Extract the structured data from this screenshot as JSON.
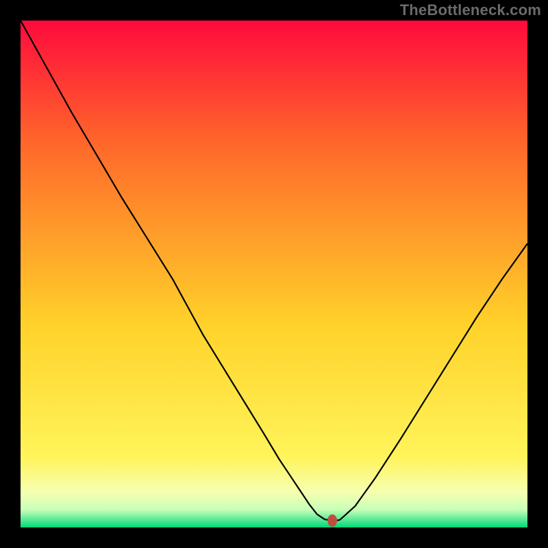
{
  "watermark": "TheBottleneck.com",
  "colors": {
    "page_bg": "#000000",
    "watermark": "#6b6b6b",
    "curve": "#000000",
    "marker_fill": "#be4f3e",
    "gradient_top": "#ff0a3c",
    "gradient_upper_mid": "#ff6a2a",
    "gradient_mid": "#ffd22a",
    "gradient_lower_mid": "#fff45a",
    "gradient_pale": "#f6ffb0",
    "gradient_pale2": "#c8ffb8",
    "gradient_bottom": "#00d97a"
  },
  "layout": {
    "outer_w": 800,
    "outer_h": 800,
    "border": 30,
    "inner_w": 740,
    "inner_h": 740
  },
  "chart_data": {
    "type": "line",
    "title": "",
    "xlabel": "",
    "ylabel": "",
    "xlim": [
      0,
      100
    ],
    "ylim": [
      0,
      100
    ],
    "x": [
      0,
      5,
      10,
      15,
      20,
      25,
      30,
      33,
      36,
      40,
      44,
      48,
      51,
      53,
      55,
      57,
      58.5,
      60,
      62,
      63,
      66,
      70,
      75,
      80,
      85,
      90,
      95,
      100
    ],
    "curve_y": [
      100,
      91,
      82,
      73.5,
      65,
      57,
      49,
      43.5,
      38,
      31.5,
      25,
      18.5,
      13.5,
      10.5,
      7.5,
      4.5,
      2.6,
      1.6,
      1.3,
      1.5,
      4.2,
      9.8,
      17.5,
      25.5,
      33.5,
      41.5,
      49,
      56
    ],
    "marker": {
      "x": 61.5,
      "y": 1.35
    },
    "gradient_stops": [
      {
        "offset": 0.0,
        "color_key": "gradient_top"
      },
      {
        "offset": 0.25,
        "color_key": "gradient_upper_mid"
      },
      {
        "offset": 0.6,
        "color_key": "gradient_mid"
      },
      {
        "offset": 0.86,
        "color_key": "gradient_lower_mid"
      },
      {
        "offset": 0.93,
        "color_key": "gradient_pale"
      },
      {
        "offset": 0.965,
        "color_key": "gradient_pale2"
      },
      {
        "offset": 1.0,
        "color_key": "gradient_bottom"
      }
    ]
  }
}
